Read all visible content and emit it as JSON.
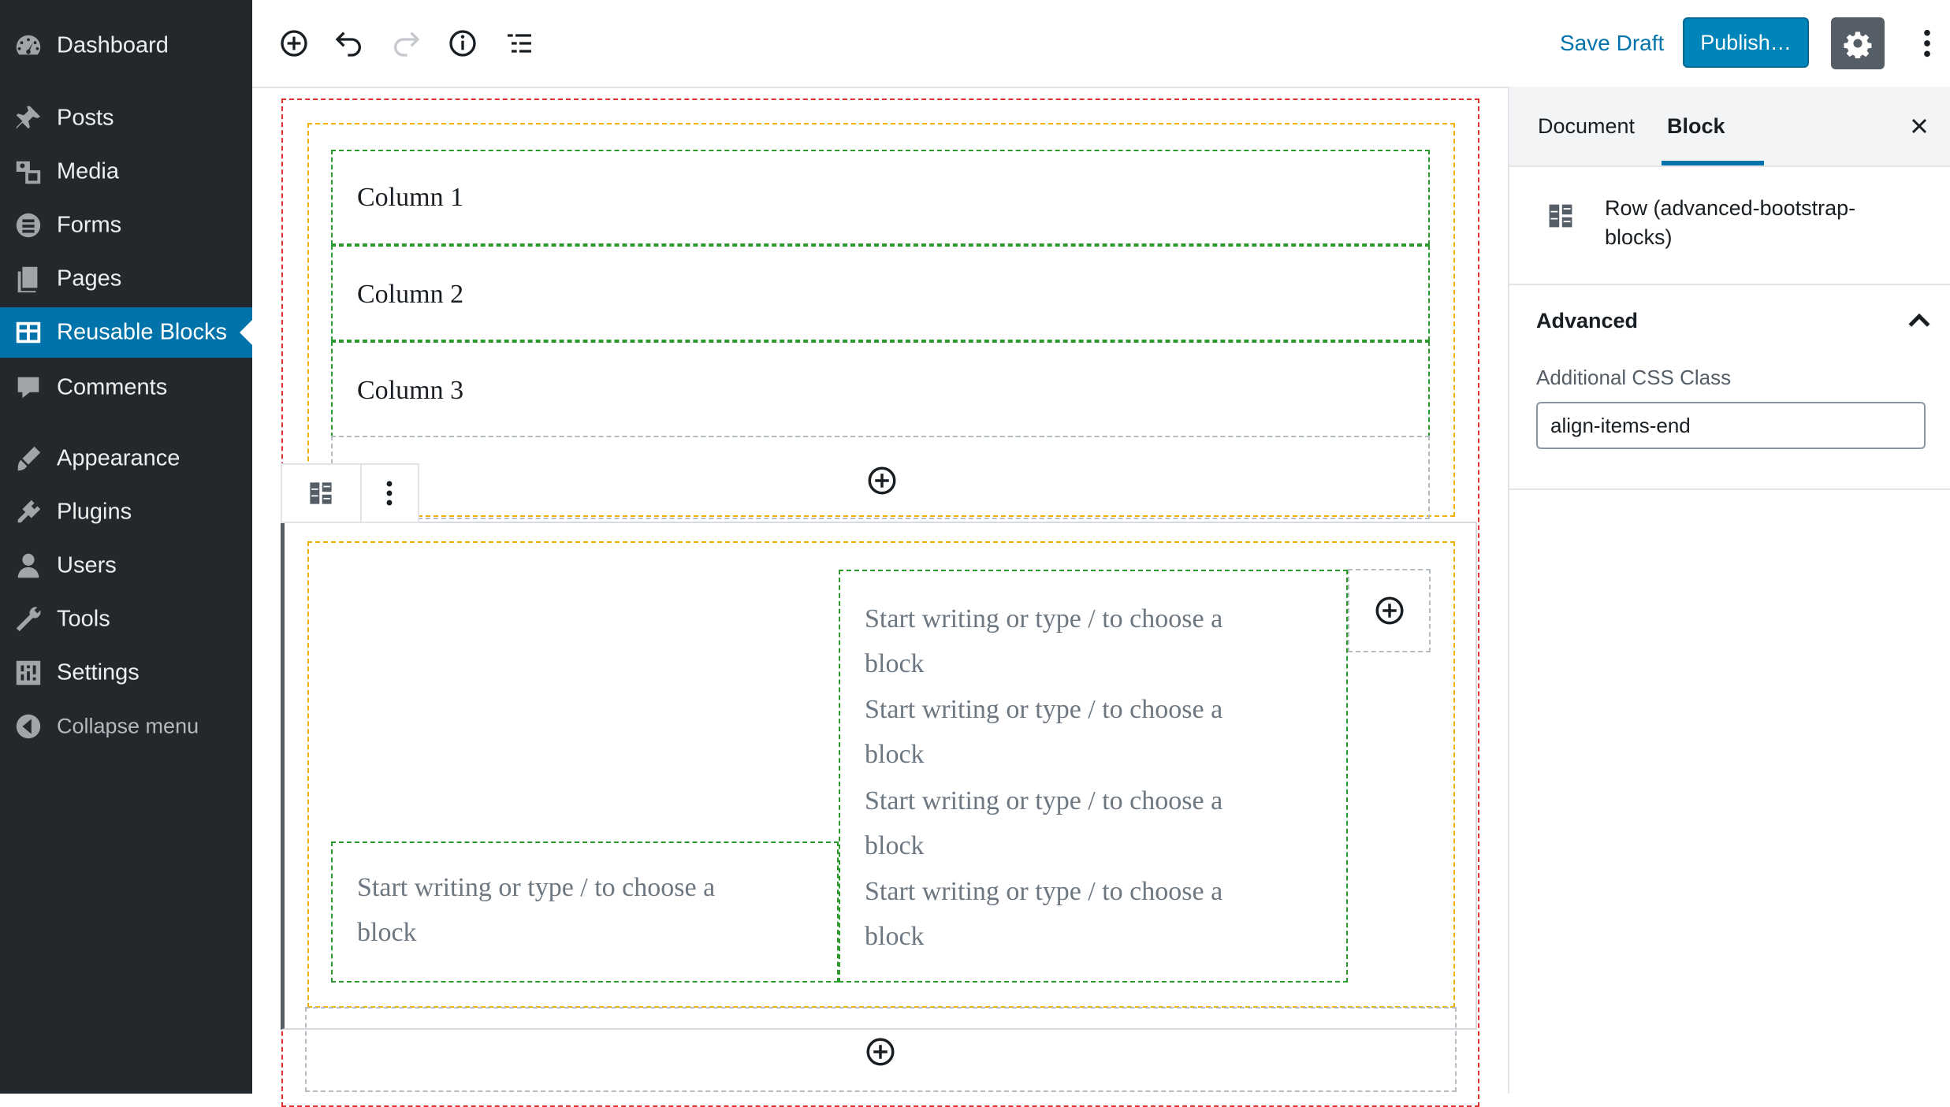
{
  "admin_menu": {
    "items": [
      {
        "label": "Dashboard",
        "icon": "dashboard-icon"
      },
      {
        "label": "Posts",
        "icon": "pin-icon"
      },
      {
        "label": "Media",
        "icon": "media-icon"
      },
      {
        "label": "Forms",
        "icon": "forms-icon"
      },
      {
        "label": "Pages",
        "icon": "pages-icon"
      },
      {
        "label": "Reusable Blocks",
        "icon": "blocks-icon",
        "current": true
      },
      {
        "label": "Comments",
        "icon": "comment-icon"
      },
      {
        "label": "Appearance",
        "icon": "brush-icon"
      },
      {
        "label": "Plugins",
        "icon": "plugin-icon"
      },
      {
        "label": "Users",
        "icon": "user-icon"
      },
      {
        "label": "Tools",
        "icon": "wrench-icon"
      },
      {
        "label": "Settings",
        "icon": "settings-icon"
      }
    ],
    "collapse_label": "Collapse menu"
  },
  "toolbar": {
    "save_draft_label": "Save Draft",
    "publish_label": "Publish…"
  },
  "editor": {
    "row1_columns": [
      "Column 1",
      "Column 2",
      "Column 3"
    ],
    "placeholder_lines": [
      "Start writing or type / to choose a",
      "block"
    ]
  },
  "sidebar": {
    "tabs": {
      "document": "Document",
      "block": "Block"
    },
    "block_card_title": "Row (advanced-bootstrap-blocks)",
    "advanced_panel": {
      "title": "Advanced",
      "css_label": "Additional CSS Class",
      "css_value": "align-items-end"
    }
  },
  "colors": {
    "admin_bg": "#23282d",
    "accent": "#0073aa",
    "publish": "#0085ba",
    "red_outline": "#e03030",
    "orange_outline": "#f0b000",
    "green_outline": "#2a9b2a"
  }
}
